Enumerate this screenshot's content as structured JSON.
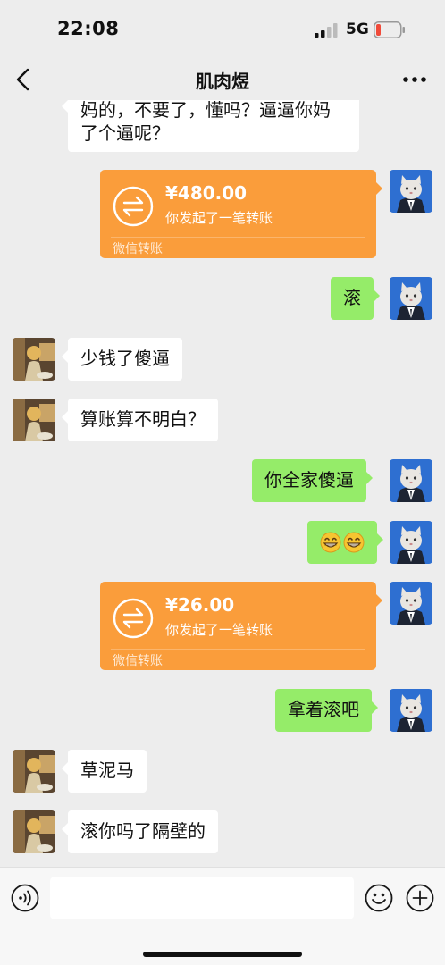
{
  "status_bar": {
    "time": "22:08",
    "network": "5G"
  },
  "nav": {
    "title": "肌肉煜",
    "icons": [
      "chevron-left-icon",
      "more-icon"
    ]
  },
  "messages": [
    {
      "side": "left",
      "type": "text",
      "lines": [
        "妈的，不要了，懂吗？逼逼你妈",
        "了个逼呢？"
      ]
    },
    {
      "side": "right",
      "type": "transfer",
      "amount": "¥480.00",
      "desc": "你发起了一笔转账",
      "label": "微信转账"
    },
    {
      "side": "right",
      "type": "text",
      "text": "滚"
    },
    {
      "side": "left",
      "type": "text",
      "text": "少钱了傻逼"
    },
    {
      "side": "left",
      "type": "text",
      "text": "算账算不明白？"
    },
    {
      "side": "right",
      "type": "text",
      "text": "你全家傻逼"
    },
    {
      "side": "right",
      "type": "emoji",
      "emoji": "😁😁"
    },
    {
      "side": "right",
      "type": "transfer",
      "amount": "¥26.00",
      "desc": "你发起了一笔转账",
      "label": "微信转账"
    },
    {
      "side": "right",
      "type": "text",
      "text": "拿着滚吧"
    },
    {
      "side": "left",
      "type": "text",
      "text": "草泥马"
    },
    {
      "side": "left",
      "type": "text",
      "text": "滚你吗了隔壁的"
    }
  ],
  "input_bar": {
    "placeholder": "",
    "icons": [
      "voice-icon",
      "emoji-icon",
      "plus-icon"
    ]
  },
  "colors": {
    "background": "#ededed",
    "my_bubble": "#95ec69",
    "their_bubble": "#ffffff",
    "transfer": "#fa9d3b"
  }
}
